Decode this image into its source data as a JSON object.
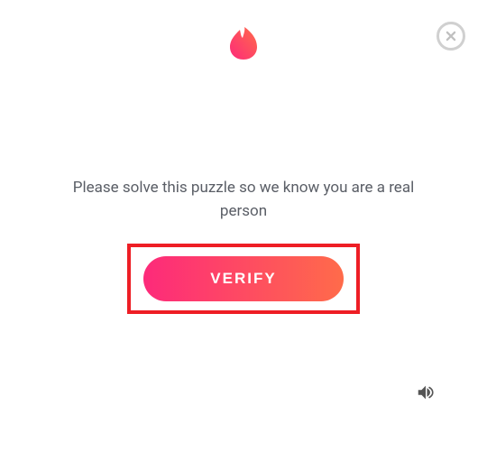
{
  "logo": {
    "name": "tinder-flame-icon"
  },
  "close": {
    "label": "Close"
  },
  "instruction": {
    "text": "Please solve this puzzle so we know you are a real person"
  },
  "verify": {
    "label": "VERIFY"
  },
  "audio": {
    "label": "Audio challenge"
  },
  "colors": {
    "gradient_start": "#fd2a7a",
    "gradient_end": "#ff6b4a",
    "highlight_border": "#ee1e25"
  }
}
